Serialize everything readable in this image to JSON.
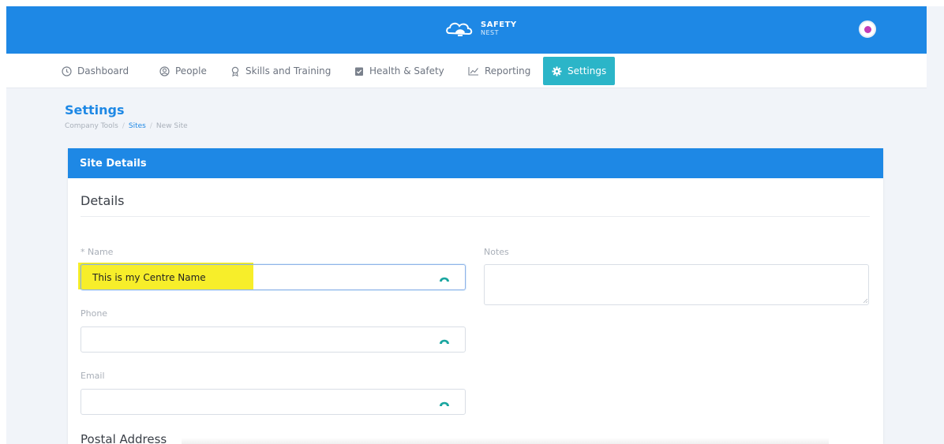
{
  "brand": {
    "name": "SAFETY",
    "sub": "NEST"
  },
  "nav": {
    "items": [
      {
        "label": "Dashboard",
        "icon": "clock-icon"
      },
      {
        "label": "People",
        "icon": "user-icon"
      },
      {
        "label": "Skills and Training",
        "icon": "award-icon"
      },
      {
        "label": "Health & Safety",
        "icon": "clipboard-icon"
      },
      {
        "label": "Reporting",
        "icon": "chart-line-icon"
      },
      {
        "label": "Settings",
        "icon": "gear-icon",
        "active": true
      }
    ]
  },
  "page": {
    "title": "Settings",
    "breadcrumb": [
      "Company Tools",
      "Sites",
      "New Site"
    ],
    "breadcrumb_sep": "/"
  },
  "card": {
    "header": "Site Details",
    "section": "Details",
    "next_section": "Postal Address",
    "fields": {
      "name": {
        "label": "* Name",
        "value": "This is my Centre Name",
        "placeholder": ""
      },
      "phone": {
        "label": "Phone",
        "value": "",
        "placeholder": ""
      },
      "email": {
        "label": "Email",
        "value": "",
        "placeholder": ""
      },
      "notes": {
        "label": "Notes",
        "value": "",
        "placeholder": ""
      }
    }
  },
  "colors": {
    "primary": "#1e88e5",
    "active_tab": "#2bb5c8",
    "highlight": "#f7ee2a",
    "field_icon": "#1aa6a0"
  }
}
